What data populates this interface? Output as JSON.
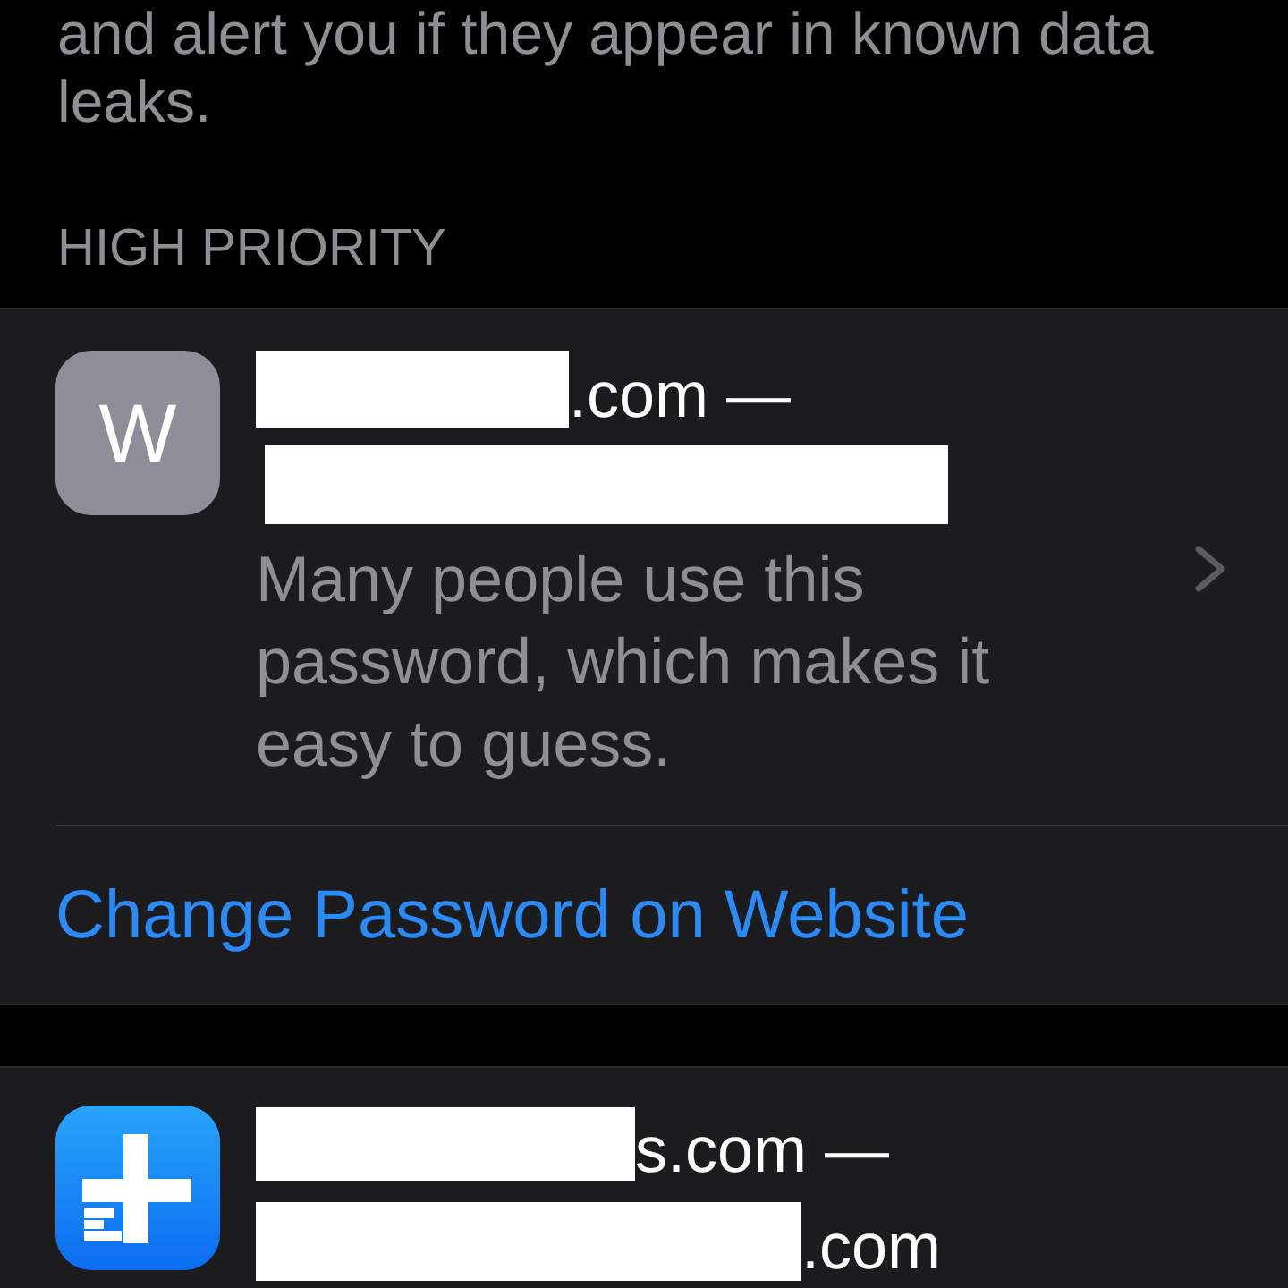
{
  "intro": "and alert you if they appear in known data leaks.",
  "section": {
    "header": "HIGH PRIORITY",
    "items": [
      {
        "icon": {
          "kind": "monogram",
          "letter": "W"
        },
        "title": [
          {
            "kind": "redacted"
          },
          {
            "kind": "text",
            "text": ".com —"
          }
        ],
        "subtitle": [
          {
            "kind": "redacted"
          }
        ],
        "description": "Many people use this password, which makes it easy to guess.",
        "action": "Change Password on Website"
      },
      {
        "icon": {
          "kind": "app"
        },
        "title": [
          {
            "kind": "redacted"
          },
          {
            "kind": "text",
            "text": "s.com —"
          }
        ],
        "subtitle": [
          {
            "kind": "redacted"
          },
          {
            "kind": "text",
            "text": ".com"
          }
        ]
      }
    ]
  }
}
